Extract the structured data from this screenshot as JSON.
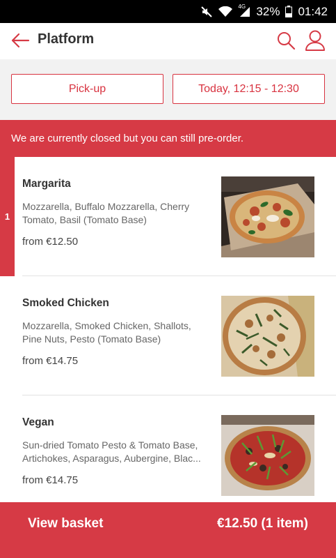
{
  "status_bar": {
    "battery": "32%",
    "time": "01:42",
    "network": "4G"
  },
  "header": {
    "title": "Platform"
  },
  "order_options": {
    "mode": "Pick-up",
    "time_slot": "Today, 12:15 - 12:30"
  },
  "banner": {
    "text": "We are currently closed but you can still pre-order."
  },
  "menu": {
    "items": [
      {
        "name": "Margarita",
        "description": "Mozzarella, Buffalo Mozzarella, Cherry Tomato, Basil (Tomato Base)",
        "price": "from €12.50",
        "quantity": "1"
      },
      {
        "name": "Smoked Chicken",
        "description": "Mozzarella, Smoked Chicken, Shallots, Pine Nuts, Pesto (Tomato Base)",
        "price": "from €14.75",
        "quantity": ""
      },
      {
        "name": "Vegan",
        "description": "Sun-dried Tomato Pesto & Tomato Base, Artichokes, Asparagus, Aubergine, Blac...",
        "price": "from €14.75",
        "quantity": ""
      }
    ]
  },
  "basket": {
    "label": "View basket",
    "total": "€12.50 (1 item)"
  },
  "colors": {
    "accent": "#d63a45",
    "status_bar": "#000000"
  }
}
